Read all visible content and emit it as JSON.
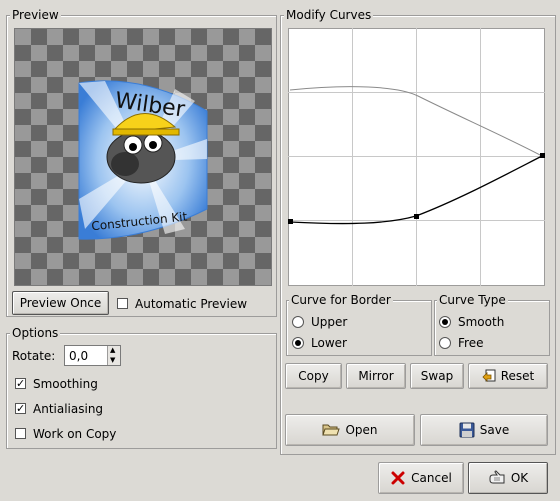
{
  "preview": {
    "frame_label": "Preview",
    "preview_once_label": "Preview Once",
    "automatic_preview_label": "Automatic Preview",
    "automatic_preview_checked": false,
    "image_text_top": "Wilber",
    "image_text_bottom": "Construction Kit"
  },
  "curves": {
    "frame_label": "Modify Curves"
  },
  "options": {
    "frame_label": "Options",
    "rotate_label": "Rotate:",
    "rotate_value": "0,0",
    "smoothing_label": "Smoothing",
    "smoothing_checked": true,
    "antialiasing_label": "Antialiasing",
    "antialiasing_checked": true,
    "work_on_copy_label": "Work on Copy",
    "work_on_copy_checked": false
  },
  "curve_for_border": {
    "frame_label": "Curve for Border",
    "upper_label": "Upper",
    "lower_label": "Lower",
    "selected": "Lower"
  },
  "curve_type": {
    "frame_label": "Curve Type",
    "smooth_label": "Smooth",
    "free_label": "Free",
    "selected": "Smooth"
  },
  "actions": {
    "copy_label": "Copy",
    "mirror_label": "Mirror",
    "swap_label": "Swap",
    "reset_label": "Reset",
    "open_label": "Open",
    "save_label": "Save"
  },
  "dialog": {
    "cancel_label": "Cancel",
    "ok_label": "OK"
  },
  "colors": {
    "background": "#dcdad5",
    "check_dark": "#666666",
    "check_light": "#999999",
    "cancel_icon": "#cc0000"
  }
}
